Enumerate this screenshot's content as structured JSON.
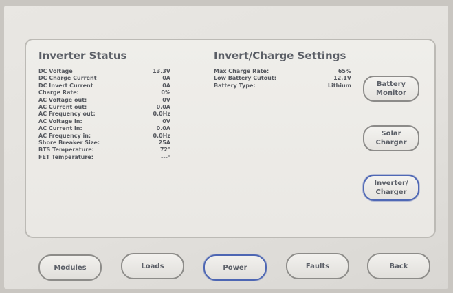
{
  "inverter_status": {
    "title": "Inverter Status",
    "rows": [
      {
        "label": "DC Voltage",
        "value": "13.3V"
      },
      {
        "label": "DC Charge Current",
        "value": "0A"
      },
      {
        "label": "DC Invert Current",
        "value": "0A"
      },
      {
        "label": "Charge Rate:",
        "value": "0%"
      },
      {
        "label": "AC Voltage out:",
        "value": "0V"
      },
      {
        "label": "AC Current out:",
        "value": "0.0A"
      },
      {
        "label": "AC Frequency out:",
        "value": "0.0Hz"
      },
      {
        "label": "AC Voltage in:",
        "value": "0V"
      },
      {
        "label": "AC Current in:",
        "value": "0.0A"
      },
      {
        "label": "AC Frequency in:",
        "value": "0.0Hz"
      },
      {
        "label": "Shore Breaker Size:",
        "value": "25A"
      },
      {
        "label": "BTS Temperature:",
        "value": "72°"
      },
      {
        "label": "FET Temperature:",
        "value": "---°"
      }
    ]
  },
  "invert_charge_settings": {
    "title": "Invert/Charge Settings",
    "rows": [
      {
        "label": "Max Charge Rate:",
        "value": "65%"
      },
      {
        "label": "Low Battery Cutout:",
        "value": "12.1V"
      },
      {
        "label": "Battery Type:",
        "value": "Lithium"
      }
    ]
  },
  "side_buttons": [
    {
      "label": "Battery\nMonitor",
      "active": false
    },
    {
      "label": "Solar\nCharger",
      "active": false
    },
    {
      "label": "Inverter/\nCharger",
      "active": true
    }
  ],
  "nav": [
    {
      "label": "Modules",
      "active": false
    },
    {
      "label": "Loads",
      "active": false
    },
    {
      "label": "Power",
      "active": true
    },
    {
      "label": "Faults",
      "active": false
    },
    {
      "label": "Back",
      "active": false
    }
  ],
  "colors": {
    "text": "#575a60",
    "active_border": "#4f68b5",
    "button_border": "#8c8b89",
    "panel_border": "#bcbab5"
  }
}
